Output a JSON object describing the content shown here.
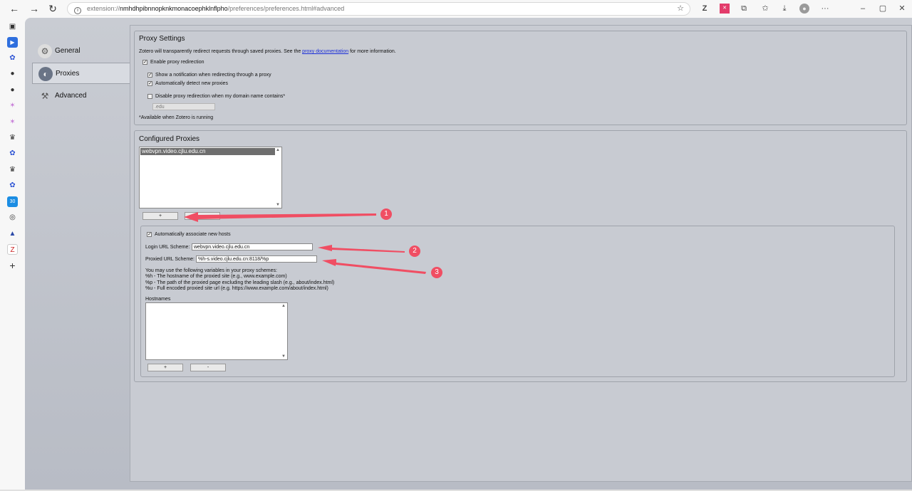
{
  "browser": {
    "back": "←",
    "forward": "→",
    "reload": "↻",
    "info_glyph": "i",
    "url_prefix": "extension://",
    "url_host": "nmhdhpibnnopknkmonacoephklnflpho",
    "url_path": "/preferences/preferences.html#advanced",
    "toolbar_icons": [
      "star-icon",
      "zotero-icon",
      "extension-red-icon",
      "extensions-icon",
      "favorites-icon",
      "download-icon",
      "profile-icon",
      "more-icon"
    ],
    "favorite_glyph": "☆",
    "more_glyph": "···",
    "window_min": "–",
    "window_max": "▢",
    "window_close": "✕"
  },
  "sidebar": {
    "icons": [
      "sidebar-icon",
      "play-icon",
      "paw-icon",
      "github-icon",
      "github-icon",
      "pinwheel-icon",
      "pinwheel-icon",
      "crown-icon",
      "paw-icon",
      "crown-icon",
      "paw-icon",
      "calendar-icon",
      "globe-icon",
      "navigation-icon",
      "zotero-icon",
      "add-icon"
    ],
    "add_glyph": "+"
  },
  "prefs": {
    "tabs": [
      {
        "label": "General",
        "icon": "gear-icon"
      },
      {
        "label": "Proxies",
        "icon": "proxy-icon"
      },
      {
        "label": "Advanced",
        "icon": "tools-icon"
      }
    ],
    "selected_tab": "Proxies"
  },
  "proxy_settings": {
    "title": "Proxy Settings",
    "description_before": "Zotero will transparently redirect requests through saved proxies. See the ",
    "description_link": "proxy documentation",
    "description_after": " for more information.",
    "enable_redirection": {
      "label": "Enable proxy redirection",
      "checked": true
    },
    "show_notification": {
      "label": "Show a notification when redirecting through a proxy",
      "checked": true
    },
    "auto_detect": {
      "label": "Automatically detect new proxies",
      "checked": true
    },
    "disable_domain": {
      "label": "Disable proxy redirection when my domain name contains*",
      "checked": false
    },
    "domain_value": ".edu",
    "footnote": "*Available when Zotero is running",
    "check_glyph": "✓"
  },
  "configured_proxies": {
    "title": "Configured Proxies",
    "proxies": [
      "webvpn.video.cjlu.edu.cn"
    ],
    "add_label": "+",
    "remove_label": "-",
    "auto_associate": {
      "label": "Automatically associate new hosts",
      "checked": true
    },
    "login_label": "Login URL Scheme:",
    "login_value": "webvpn.video.cjlu.edu.cn",
    "proxied_label": "Proxied URL Scheme:",
    "proxied_value": "%h-s.video.cjlu.edu.cn:8118/%p",
    "vars_intro": "You may use the following variables in your proxy schemes:",
    "var_h": "%h - The hostname of the proxied site (e.g., www.example.com)",
    "var_p": "%p - The path of the proxied page excluding the leading slash (e.g., about/index.html)",
    "var_u": "%u - Full encoded proxied site url (e.g. https://www.example.com/about/index.html)",
    "hostnames_label": "Hostnames",
    "host_add_label": "+",
    "host_remove_label": "-",
    "scroll_up": "▲",
    "scroll_down": "▼"
  },
  "annotations": {
    "markers": [
      "1",
      "2",
      "3"
    ],
    "color": "#f04e63"
  }
}
